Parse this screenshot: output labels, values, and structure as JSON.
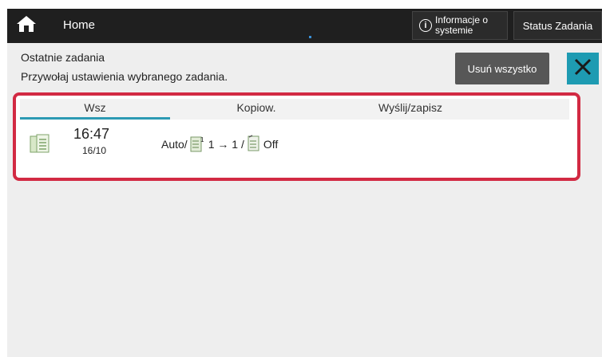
{
  "topbar": {
    "home_label": "Home",
    "info_label": "Informacje o\nsystemie",
    "status_label": "Status Zadania"
  },
  "panel": {
    "title": "Ostatnie zadania",
    "subtitle": "Przywołaj ustawienia wybranego zadania.",
    "delete_all_label": "Usuń wszystko"
  },
  "tabs": [
    {
      "label": "Wsz",
      "active": true
    },
    {
      "label": "Kopiow.",
      "active": false
    },
    {
      "label": "Wyślij/zapisz",
      "active": false
    }
  ],
  "jobs": [
    {
      "time": "16:47",
      "date": "16/10",
      "color_mode": "Auto/",
      "pages": "1 → 1 /",
      "staple": "Off",
      "icon": "copy-job-icon"
    }
  ],
  "colors": {
    "topbar_bg": "#1f1f1f",
    "accent": "#1e9bb2",
    "highlight_frame": "#d22a43",
    "button_gray": "#575757",
    "background": "#eeeeee"
  }
}
